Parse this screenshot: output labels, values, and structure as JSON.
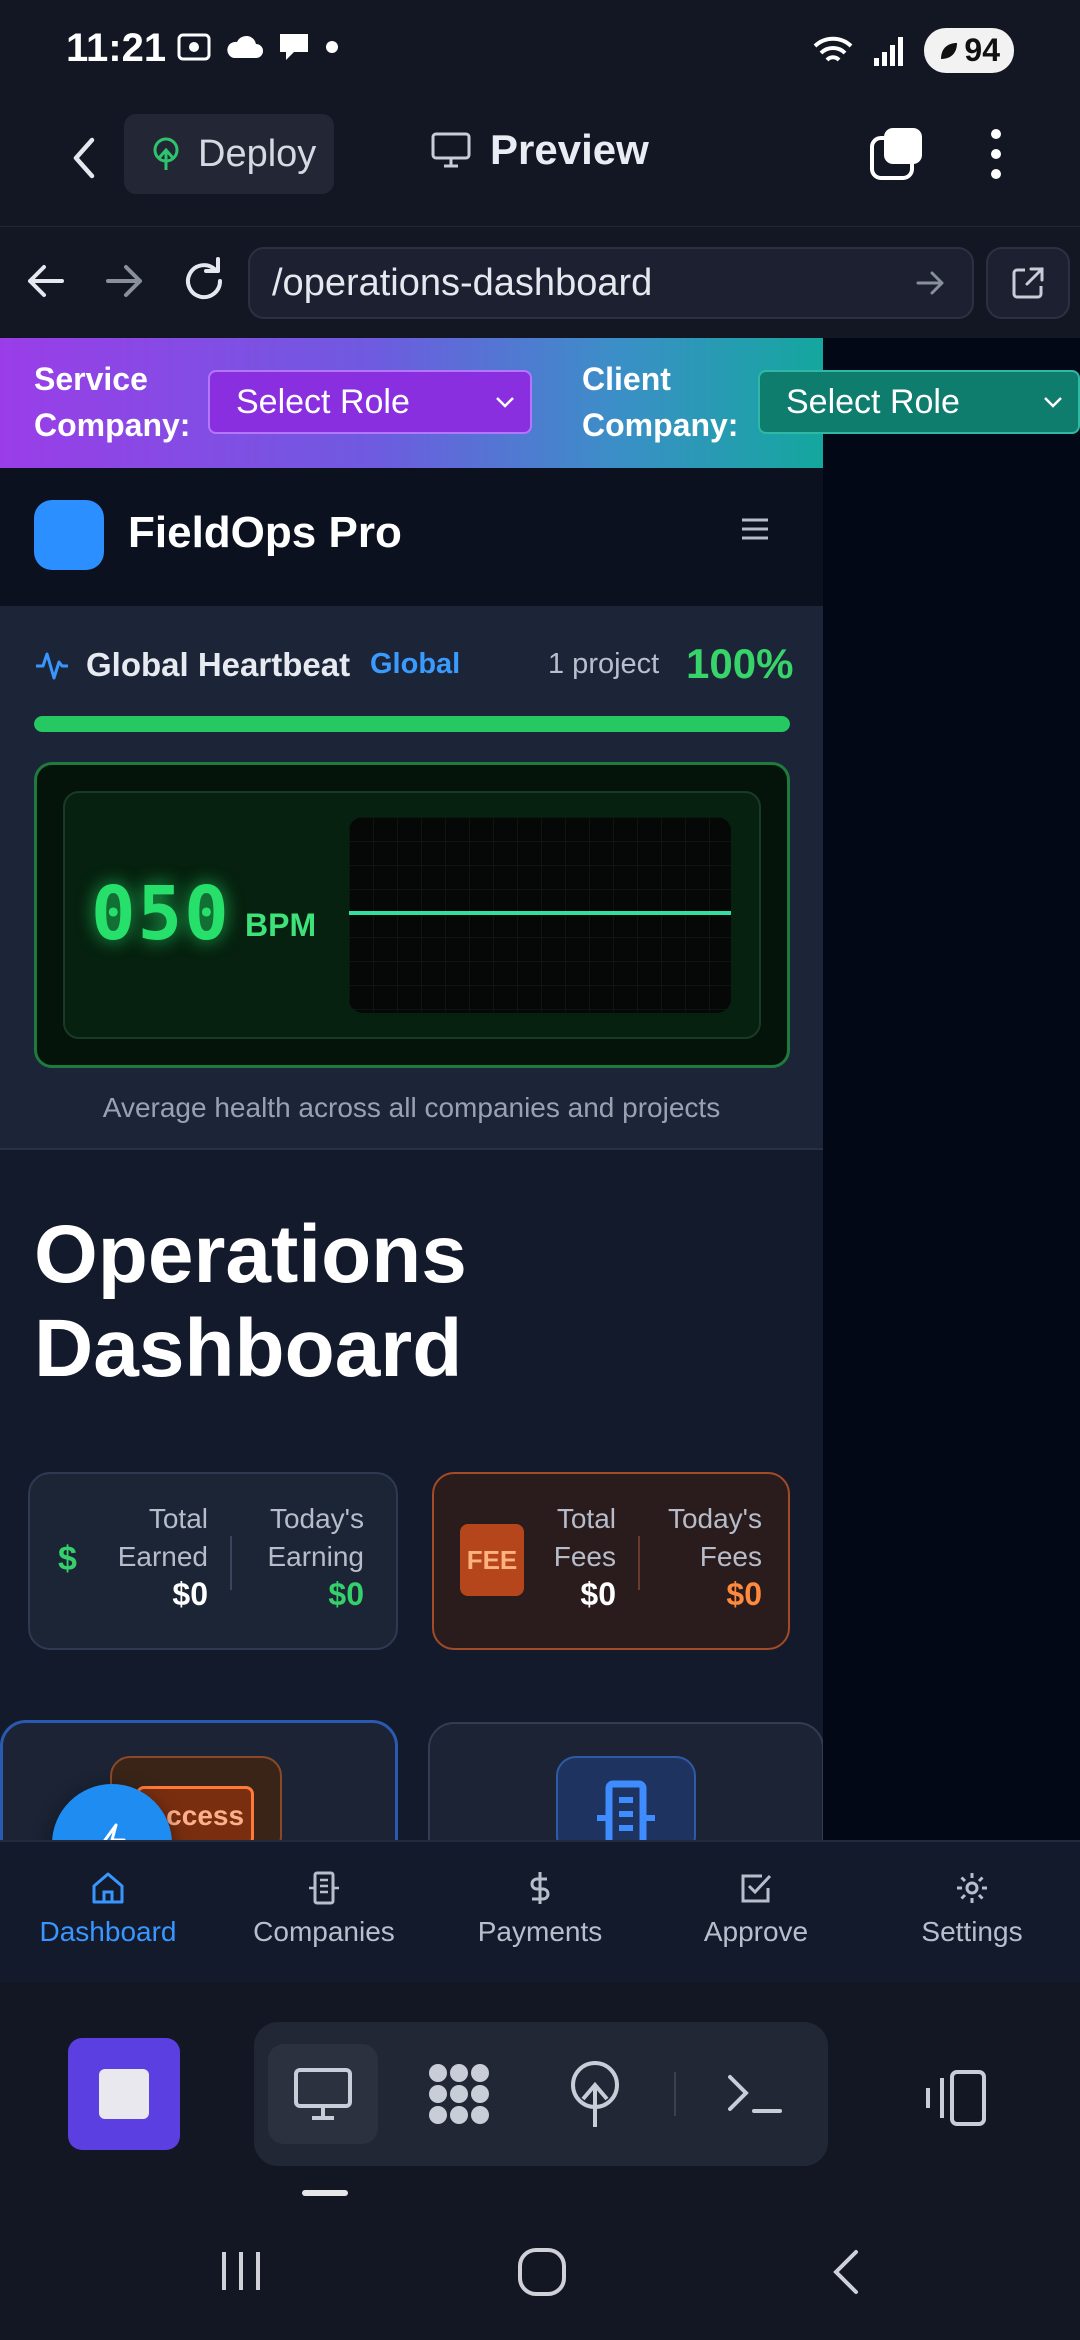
{
  "status_bar": {
    "time": "11:21",
    "battery": "94"
  },
  "app_header": {
    "deploy_label": "Deploy",
    "preview_label": "Preview"
  },
  "browser": {
    "url": "/operations-dashboard"
  },
  "role_bar": {
    "service_label_line1": "Service",
    "service_label_line2": "Company:",
    "service_select": "Select Role",
    "client_label_line1": "Client",
    "client_label_line2": "Company:",
    "client_select": "Select Role"
  },
  "brand": {
    "name": "FieldOps Pro"
  },
  "heartbeat": {
    "title": "Global Heartbeat",
    "scope": "Global",
    "project_count": "1 project",
    "percent_text": "100%",
    "percent_value": 100,
    "bpm": "050",
    "bpm_unit": "BPM",
    "caption": "Average health across all companies and projects"
  },
  "page": {
    "title_line1": "Operations",
    "title_line2": "Dashboard"
  },
  "earnings": {
    "total_label_1": "Total",
    "total_label_2": "Earned",
    "total_value": "$0",
    "today_label_1": "Today's",
    "today_label_2": "Earning",
    "today_value": "$0"
  },
  "fees": {
    "badge": "FEE",
    "total_label_1": "Total",
    "total_label_2": "Fees",
    "total_value": "$0",
    "today_label_1": "Today's",
    "today_label_2": "Fees",
    "today_value": "$0"
  },
  "tiles": {
    "access_label": "Access"
  },
  "bottom_nav": [
    {
      "label": "Dashboard",
      "icon": "home-icon"
    },
    {
      "label": "Companies",
      "icon": "building-icon"
    },
    {
      "label": "Payments",
      "icon": "dollar-icon"
    },
    {
      "label": "Approve",
      "icon": "check-square-icon"
    },
    {
      "label": "Settings",
      "icon": "gear-icon"
    }
  ],
  "colors": {
    "accent_blue": "#3a96ff",
    "health_green": "#26c862",
    "fee_orange": "#ff8a3d",
    "stop_purple": "#5b3fe0"
  }
}
